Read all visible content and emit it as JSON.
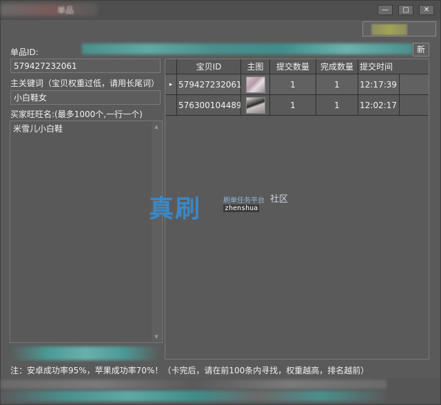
{
  "window": {
    "title": "单品",
    "minimize_label": "—",
    "maximize_label": "□",
    "close_label": "✕"
  },
  "left": {
    "item_id_label": "单品ID:",
    "item_id_value": "579427232061",
    "keyword_label": "主关键词（宝贝权重过低，请用长尾词）",
    "keyword_value": "小白鞋女",
    "buyers_label": "买家旺旺名:(最多1000个,一行一个)",
    "buyers_value": "米雪儿小白鞋"
  },
  "grid": {
    "columns": [
      "宝贝ID",
      "主图",
      "提交数量",
      "完成数量",
      "提交时间"
    ],
    "rows": [
      {
        "item_id": "579427232061",
        "submitted": "1",
        "completed": "1",
        "time": "12:17:39",
        "image_icon": "shoe-thumbnail"
      },
      {
        "item_id": "576300104489",
        "submitted": "1",
        "completed": "1",
        "time": "12:02:17",
        "image_icon": "shoe-thumbnail"
      }
    ],
    "row_indicator": "▸"
  },
  "watermark": {
    "big": "真刷",
    "small": "刷单任务平台",
    "she": "社区",
    "en": "zhenshua"
  },
  "refresh_label": "新",
  "note": "注：安卓成功率95%，苹果成功率70%！（卡完后，请在前100条内寻找，权重越高，排名越前）",
  "colors": {
    "background": "#5a5a5a",
    "teal_blur": "#3aa8a0",
    "watermark_blue": "#3a88c8"
  }
}
